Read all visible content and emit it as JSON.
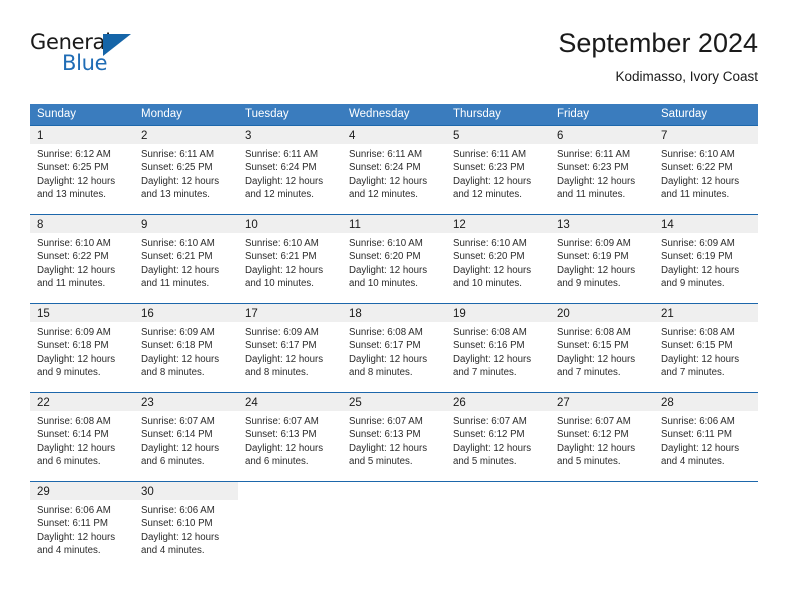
{
  "brand": {
    "name_part1": "General",
    "name_part2": "Blue",
    "accent_color": "#1565a8"
  },
  "header": {
    "month_title": "September 2024",
    "location": "Kodimasso, Ivory Coast"
  },
  "calendar": {
    "header_color": "#3a7cbe",
    "row_divider_color": "#1d67ab",
    "date_band_color": "#efefef",
    "weekdays": [
      "Sunday",
      "Monday",
      "Tuesday",
      "Wednesday",
      "Thursday",
      "Friday",
      "Saturday"
    ],
    "weeks": [
      [
        {
          "date": "1",
          "sunrise": "Sunrise: 6:12 AM",
          "sunset": "Sunset: 6:25 PM",
          "daylight_line1": "Daylight: 12 hours",
          "daylight_line2": "and 13 minutes."
        },
        {
          "date": "2",
          "sunrise": "Sunrise: 6:11 AM",
          "sunset": "Sunset: 6:25 PM",
          "daylight_line1": "Daylight: 12 hours",
          "daylight_line2": "and 13 minutes."
        },
        {
          "date": "3",
          "sunrise": "Sunrise: 6:11 AM",
          "sunset": "Sunset: 6:24 PM",
          "daylight_line1": "Daylight: 12 hours",
          "daylight_line2": "and 12 minutes."
        },
        {
          "date": "4",
          "sunrise": "Sunrise: 6:11 AM",
          "sunset": "Sunset: 6:24 PM",
          "daylight_line1": "Daylight: 12 hours",
          "daylight_line2": "and 12 minutes."
        },
        {
          "date": "5",
          "sunrise": "Sunrise: 6:11 AM",
          "sunset": "Sunset: 6:23 PM",
          "daylight_line1": "Daylight: 12 hours",
          "daylight_line2": "and 12 minutes."
        },
        {
          "date": "6",
          "sunrise": "Sunrise: 6:11 AM",
          "sunset": "Sunset: 6:23 PM",
          "daylight_line1": "Daylight: 12 hours",
          "daylight_line2": "and 11 minutes."
        },
        {
          "date": "7",
          "sunrise": "Sunrise: 6:10 AM",
          "sunset": "Sunset: 6:22 PM",
          "daylight_line1": "Daylight: 12 hours",
          "daylight_line2": "and 11 minutes."
        }
      ],
      [
        {
          "date": "8",
          "sunrise": "Sunrise: 6:10 AM",
          "sunset": "Sunset: 6:22 PM",
          "daylight_line1": "Daylight: 12 hours",
          "daylight_line2": "and 11 minutes."
        },
        {
          "date": "9",
          "sunrise": "Sunrise: 6:10 AM",
          "sunset": "Sunset: 6:21 PM",
          "daylight_line1": "Daylight: 12 hours",
          "daylight_line2": "and 11 minutes."
        },
        {
          "date": "10",
          "sunrise": "Sunrise: 6:10 AM",
          "sunset": "Sunset: 6:21 PM",
          "daylight_line1": "Daylight: 12 hours",
          "daylight_line2": "and 10 minutes."
        },
        {
          "date": "11",
          "sunrise": "Sunrise: 6:10 AM",
          "sunset": "Sunset: 6:20 PM",
          "daylight_line1": "Daylight: 12 hours",
          "daylight_line2": "and 10 minutes."
        },
        {
          "date": "12",
          "sunrise": "Sunrise: 6:10 AM",
          "sunset": "Sunset: 6:20 PM",
          "daylight_line1": "Daylight: 12 hours",
          "daylight_line2": "and 10 minutes."
        },
        {
          "date": "13",
          "sunrise": "Sunrise: 6:09 AM",
          "sunset": "Sunset: 6:19 PM",
          "daylight_line1": "Daylight: 12 hours",
          "daylight_line2": "and 9 minutes."
        },
        {
          "date": "14",
          "sunrise": "Sunrise: 6:09 AM",
          "sunset": "Sunset: 6:19 PM",
          "daylight_line1": "Daylight: 12 hours",
          "daylight_line2": "and 9 minutes."
        }
      ],
      [
        {
          "date": "15",
          "sunrise": "Sunrise: 6:09 AM",
          "sunset": "Sunset: 6:18 PM",
          "daylight_line1": "Daylight: 12 hours",
          "daylight_line2": "and 9 minutes."
        },
        {
          "date": "16",
          "sunrise": "Sunrise: 6:09 AM",
          "sunset": "Sunset: 6:18 PM",
          "daylight_line1": "Daylight: 12 hours",
          "daylight_line2": "and 8 minutes."
        },
        {
          "date": "17",
          "sunrise": "Sunrise: 6:09 AM",
          "sunset": "Sunset: 6:17 PM",
          "daylight_line1": "Daylight: 12 hours",
          "daylight_line2": "and 8 minutes."
        },
        {
          "date": "18",
          "sunrise": "Sunrise: 6:08 AM",
          "sunset": "Sunset: 6:17 PM",
          "daylight_line1": "Daylight: 12 hours",
          "daylight_line2": "and 8 minutes."
        },
        {
          "date": "19",
          "sunrise": "Sunrise: 6:08 AM",
          "sunset": "Sunset: 6:16 PM",
          "daylight_line1": "Daylight: 12 hours",
          "daylight_line2": "and 7 minutes."
        },
        {
          "date": "20",
          "sunrise": "Sunrise: 6:08 AM",
          "sunset": "Sunset: 6:15 PM",
          "daylight_line1": "Daylight: 12 hours",
          "daylight_line2": "and 7 minutes."
        },
        {
          "date": "21",
          "sunrise": "Sunrise: 6:08 AM",
          "sunset": "Sunset: 6:15 PM",
          "daylight_line1": "Daylight: 12 hours",
          "daylight_line2": "and 7 minutes."
        }
      ],
      [
        {
          "date": "22",
          "sunrise": "Sunrise: 6:08 AM",
          "sunset": "Sunset: 6:14 PM",
          "daylight_line1": "Daylight: 12 hours",
          "daylight_line2": "and 6 minutes."
        },
        {
          "date": "23",
          "sunrise": "Sunrise: 6:07 AM",
          "sunset": "Sunset: 6:14 PM",
          "daylight_line1": "Daylight: 12 hours",
          "daylight_line2": "and 6 minutes."
        },
        {
          "date": "24",
          "sunrise": "Sunrise: 6:07 AM",
          "sunset": "Sunset: 6:13 PM",
          "daylight_line1": "Daylight: 12 hours",
          "daylight_line2": "and 6 minutes."
        },
        {
          "date": "25",
          "sunrise": "Sunrise: 6:07 AM",
          "sunset": "Sunset: 6:13 PM",
          "daylight_line1": "Daylight: 12 hours",
          "daylight_line2": "and 5 minutes."
        },
        {
          "date": "26",
          "sunrise": "Sunrise: 6:07 AM",
          "sunset": "Sunset: 6:12 PM",
          "daylight_line1": "Daylight: 12 hours",
          "daylight_line2": "and 5 minutes."
        },
        {
          "date": "27",
          "sunrise": "Sunrise: 6:07 AM",
          "sunset": "Sunset: 6:12 PM",
          "daylight_line1": "Daylight: 12 hours",
          "daylight_line2": "and 5 minutes."
        },
        {
          "date": "28",
          "sunrise": "Sunrise: 6:06 AM",
          "sunset": "Sunset: 6:11 PM",
          "daylight_line1": "Daylight: 12 hours",
          "daylight_line2": "and 4 minutes."
        }
      ],
      [
        {
          "date": "29",
          "sunrise": "Sunrise: 6:06 AM",
          "sunset": "Sunset: 6:11 PM",
          "daylight_line1": "Daylight: 12 hours",
          "daylight_line2": "and 4 minutes."
        },
        {
          "date": "30",
          "sunrise": "Sunrise: 6:06 AM",
          "sunset": "Sunset: 6:10 PM",
          "daylight_line1": "Daylight: 12 hours",
          "daylight_line2": "and 4 minutes."
        },
        {
          "date": "",
          "sunrise": "",
          "sunset": "",
          "daylight_line1": "",
          "daylight_line2": ""
        },
        {
          "date": "",
          "sunrise": "",
          "sunset": "",
          "daylight_line1": "",
          "daylight_line2": ""
        },
        {
          "date": "",
          "sunrise": "",
          "sunset": "",
          "daylight_line1": "",
          "daylight_line2": ""
        },
        {
          "date": "",
          "sunrise": "",
          "sunset": "",
          "daylight_line1": "",
          "daylight_line2": ""
        },
        {
          "date": "",
          "sunrise": "",
          "sunset": "",
          "daylight_line1": "",
          "daylight_line2": ""
        }
      ]
    ]
  }
}
